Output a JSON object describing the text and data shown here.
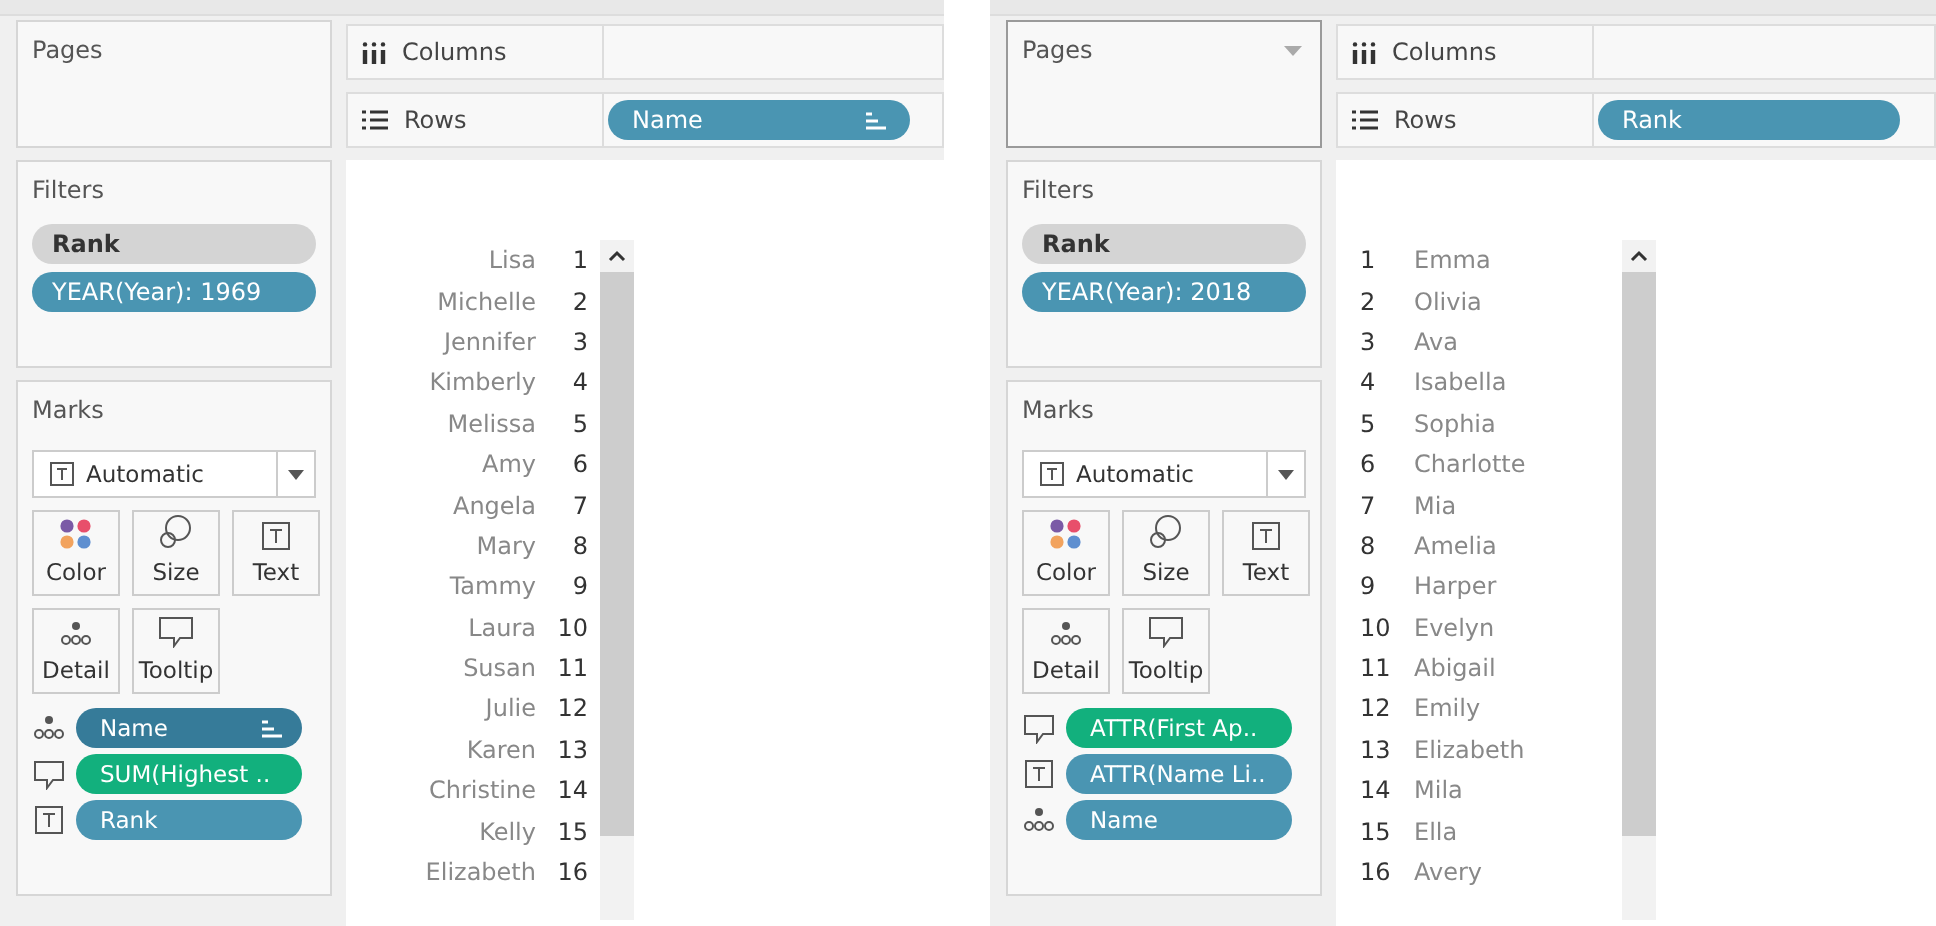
{
  "panes": [
    {
      "kind": "name_first",
      "pages": {
        "title": "Pages",
        "menu": false
      },
      "columns_shelf": {
        "label": "Columns"
      },
      "rows_shelf": {
        "label": "Rows",
        "pills": [
          {
            "label": "Name",
            "color": "#4a95b2",
            "sorted": true
          }
        ]
      },
      "filters": {
        "title": "Filters",
        "pills": [
          {
            "label": "Rank",
            "color": "#d4d4d4"
          },
          {
            "label": "YEAR(Year): 1969",
            "color": "#4a95b2"
          }
        ]
      },
      "marks": {
        "title": "Marks",
        "mark_type": "Automatic",
        "buttons": [
          {
            "label": "Color",
            "kind": "color"
          },
          {
            "label": "Size",
            "kind": "size"
          },
          {
            "label": "Text",
            "kind": "text"
          },
          {
            "label": "Detail",
            "kind": "detail"
          },
          {
            "label": "Tooltip",
            "kind": "tooltip"
          }
        ],
        "pills": [
          {
            "kind": "detail",
            "label": "Name",
            "color": "#367b99",
            "sorted": true
          },
          {
            "kind": "tooltip",
            "label": "SUM(Highest ..",
            "color": "#12b07d",
            "sorted": false
          },
          {
            "kind": "text",
            "label": "Rank",
            "color": "#4a95b2",
            "sorted": false
          }
        ]
      },
      "rows": [
        {
          "name": "Lisa",
          "rank": "1"
        },
        {
          "name": "Michelle",
          "rank": "2"
        },
        {
          "name": "Jennifer",
          "rank": "3"
        },
        {
          "name": "Kimberly",
          "rank": "4"
        },
        {
          "name": "Melissa",
          "rank": "5"
        },
        {
          "name": "Amy",
          "rank": "6"
        },
        {
          "name": "Angela",
          "rank": "7"
        },
        {
          "name": "Mary",
          "rank": "8"
        },
        {
          "name": "Tammy",
          "rank": "9"
        },
        {
          "name": "Laura",
          "rank": "10"
        },
        {
          "name": "Susan",
          "rank": "11"
        },
        {
          "name": "Julie",
          "rank": "12"
        },
        {
          "name": "Karen",
          "rank": "13"
        },
        {
          "name": "Christine",
          "rank": "14"
        },
        {
          "name": "Kelly",
          "rank": "15"
        },
        {
          "name": "Elizabeth",
          "rank": "16"
        }
      ]
    },
    {
      "kind": "rank_first",
      "pages": {
        "title": "Pages",
        "menu": true
      },
      "columns_shelf": {
        "label": "Columns"
      },
      "rows_shelf": {
        "label": "Rows",
        "pills": [
          {
            "label": "Rank",
            "color": "#4a95b2",
            "sorted": false
          }
        ]
      },
      "filters": {
        "title": "Filters",
        "pills": [
          {
            "label": "Rank",
            "color": "#d4d4d4"
          },
          {
            "label": "YEAR(Year): 2018",
            "color": "#4a95b2"
          }
        ]
      },
      "marks": {
        "title": "Marks",
        "mark_type": "Automatic",
        "buttons": [
          {
            "label": "Color",
            "kind": "color"
          },
          {
            "label": "Size",
            "kind": "size"
          },
          {
            "label": "Text",
            "kind": "text"
          },
          {
            "label": "Detail",
            "kind": "detail"
          },
          {
            "label": "Tooltip",
            "kind": "tooltip"
          }
        ],
        "pills": [
          {
            "kind": "tooltip",
            "label": "ATTR(First Ap..",
            "color": "#12b07d",
            "sorted": false
          },
          {
            "kind": "text",
            "label": "ATTR(Name Li..",
            "color": "#4a95b2",
            "sorted": false
          },
          {
            "kind": "detail",
            "label": "Name",
            "color": "#4a95b2",
            "sorted": false
          }
        ]
      },
      "rows": [
        {
          "name": "Emma",
          "rank": "1"
        },
        {
          "name": "Olivia",
          "rank": "2"
        },
        {
          "name": "Ava",
          "rank": "3"
        },
        {
          "name": "Isabella",
          "rank": "4"
        },
        {
          "name": "Sophia",
          "rank": "5"
        },
        {
          "name": "Charlotte",
          "rank": "6"
        },
        {
          "name": "Mia",
          "rank": "7"
        },
        {
          "name": "Amelia",
          "rank": "8"
        },
        {
          "name": "Harper",
          "rank": "9"
        },
        {
          "name": "Evelyn",
          "rank": "10"
        },
        {
          "name": "Abigail",
          "rank": "11"
        },
        {
          "name": "Emily",
          "rank": "12"
        },
        {
          "name": "Elizabeth",
          "rank": "13"
        },
        {
          "name": "Mila",
          "rank": "14"
        },
        {
          "name": "Ella",
          "rank": "15"
        },
        {
          "name": "Avery",
          "rank": "16"
        }
      ]
    }
  ]
}
